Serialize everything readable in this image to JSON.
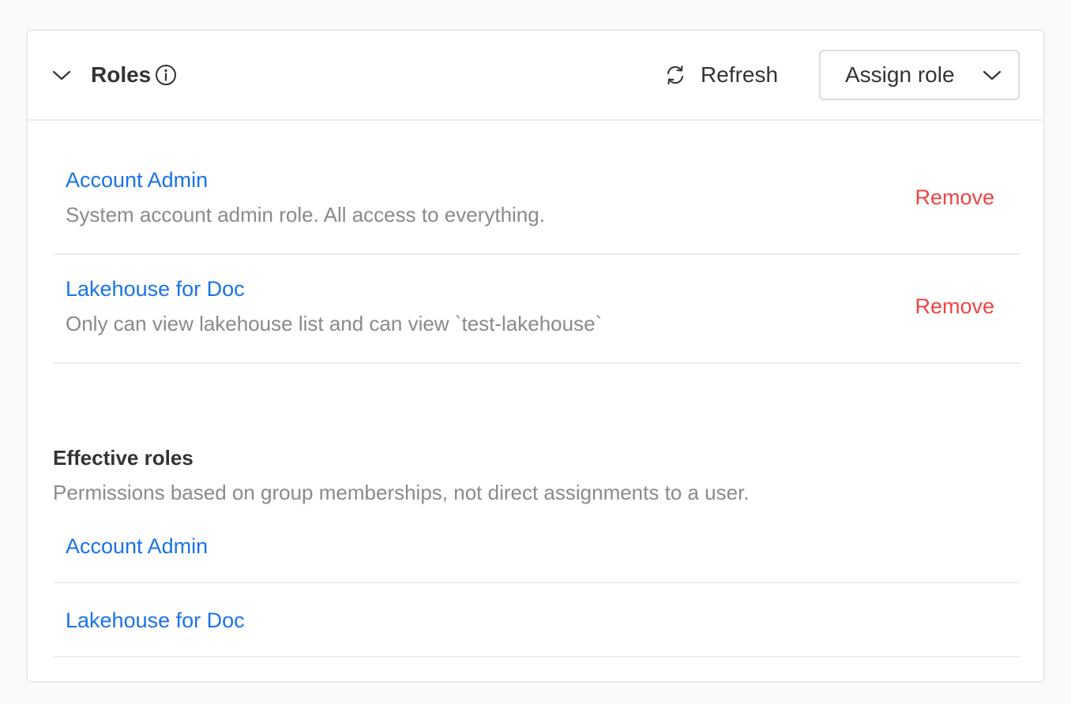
{
  "header": {
    "title": "Roles",
    "refresh_label": "Refresh",
    "assign_label": "Assign role"
  },
  "icons": {
    "collapse": "chevron-down-icon",
    "info": "info-icon",
    "refresh": "refresh-icon",
    "assign_dropdown": "chevron-down-icon"
  },
  "roles": [
    {
      "name": "Account Admin",
      "description": "System account admin role. All access to everything.",
      "action": "Remove"
    },
    {
      "name": "Lakehouse for Doc",
      "description": "Only can view lakehouse list and can view `test-lakehouse`",
      "action": "Remove"
    }
  ],
  "effective": {
    "title": "Effective roles",
    "subtitle": "Permissions based on group memberships, not direct assignments to a user.",
    "items": [
      {
        "name": "Account Admin"
      },
      {
        "name": "Lakehouse for Doc"
      }
    ]
  },
  "colors": {
    "link": "#1a73e8",
    "danger": "#ef4444",
    "muted": "#8a8a8a",
    "text": "#333333"
  }
}
